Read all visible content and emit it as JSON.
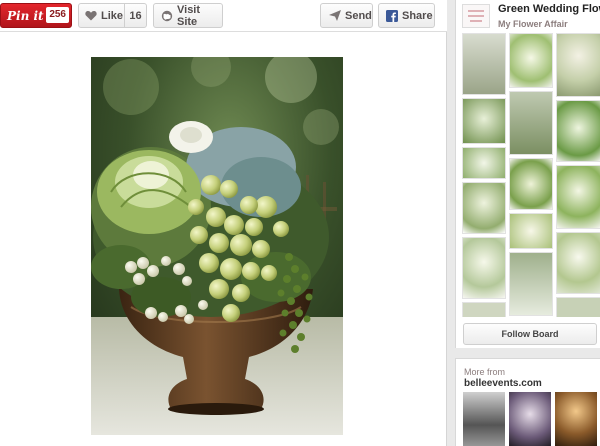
{
  "toolbar": {
    "pinit_label": "Pin it",
    "pinit_count": "256",
    "like_label": "Like",
    "like_count": "16",
    "visit_label": "Visit Site",
    "send_label": "Send",
    "share_label": "Share"
  },
  "photo": {
    "subject": "green hydrangea, cabbage and grape centerpiece in a bronze urn"
  },
  "board": {
    "title": "Green Wedding Flow…",
    "owner": "My Flower Affair",
    "follow_label": "Follow Board",
    "thumb_count": 12
  },
  "more_from": {
    "label": "More from",
    "source": "belleevents.com"
  },
  "colors": {
    "pinit_red": "#cb2027",
    "accent_text": "#524d4d"
  }
}
